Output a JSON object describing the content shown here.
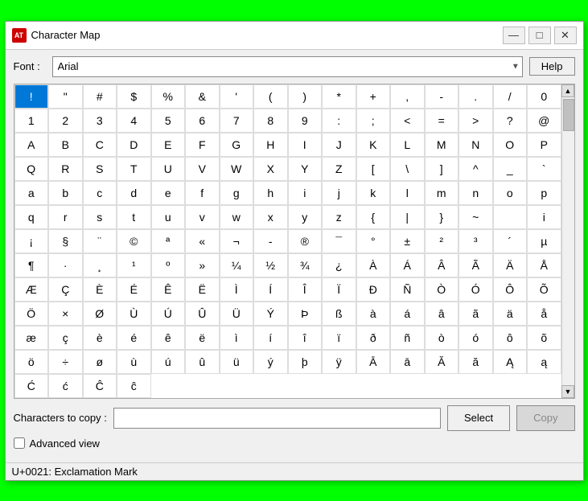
{
  "window": {
    "title": "Character Map",
    "icon_text": "AT"
  },
  "title_controls": {
    "minimize": "—",
    "maximize": "□",
    "close": "✕"
  },
  "font_row": {
    "label": "Font :",
    "font_name": "Arial",
    "help_label": "Help"
  },
  "characters": [
    "!",
    "\"",
    "#",
    "$",
    "%",
    "&",
    "'",
    "(",
    ")",
    "*",
    "+",
    ",",
    "-",
    ".",
    "/",
    "0",
    "1",
    "2",
    "3",
    "4",
    "5",
    "6",
    "7",
    "8",
    "9",
    ":",
    ";",
    "<",
    "=",
    ">",
    "?",
    "@",
    "A",
    "B",
    "C",
    "D",
    "E",
    "F",
    "G",
    "H",
    "I",
    "J",
    "K",
    "L",
    "M",
    "N",
    "O",
    "P",
    "Q",
    "R",
    "S",
    "T",
    "U",
    "V",
    "W",
    "X",
    "Y",
    "Z",
    "[",
    "\\",
    "]",
    "^",
    "_",
    "`",
    "a",
    "b",
    "c",
    "d",
    "e",
    "f",
    "g",
    "h",
    "i",
    "j",
    "k",
    "l",
    "m",
    "n",
    "o",
    "p",
    "q",
    "r",
    "s",
    "t",
    "u",
    "v",
    "w",
    "x",
    "y",
    "z",
    "{",
    "|",
    "}",
    "~",
    " ",
    "i",
    "¡",
    "§",
    "¨",
    "©",
    "ª",
    "«",
    "¬",
    "-",
    "®",
    "¯",
    "°",
    "±",
    "²",
    "³",
    "´",
    "µ",
    "¶",
    "·",
    "¸",
    "¹",
    "º",
    "»",
    "¼",
    "½",
    "¾",
    "¿",
    "À",
    "Á",
    "Â",
    "Ã",
    "Ä",
    "Å",
    "Æ",
    "Ç",
    "È",
    "É",
    "Ê",
    "Ë",
    "Ì",
    "Í",
    "Î",
    "Ï",
    "Ð",
    "Ñ",
    "Ò",
    "Ó",
    "Ô",
    "Õ",
    "Ö",
    "×",
    "Ø",
    "Ù",
    "Ú",
    "Û",
    "Ü",
    "Ý",
    "Þ",
    "ß",
    "à",
    "á",
    "â",
    "ã",
    "ä",
    "å",
    "æ",
    "ç",
    "è",
    "é",
    "ê",
    "ë",
    "ì",
    "í",
    "î",
    "ï",
    "ð",
    "ñ",
    "ò",
    "ó",
    "ô",
    "õ",
    "ö",
    "÷",
    "ø",
    "ù",
    "ú",
    "û",
    "ü",
    "ý",
    "þ",
    "ÿ",
    "Ā",
    "ā",
    "Ă",
    "ă",
    "Ą",
    "ą",
    "Ć",
    "ć",
    "Ĉ",
    "ĉ"
  ],
  "bottom": {
    "chars_to_copy_label": "Characters to copy :",
    "chars_input_value": "",
    "select_label": "Select",
    "copy_label": "Copy"
  },
  "advanced": {
    "checkbox_checked": false,
    "label": "Advanced view"
  },
  "status": {
    "text": "U+0021: Exclamation Mark"
  }
}
